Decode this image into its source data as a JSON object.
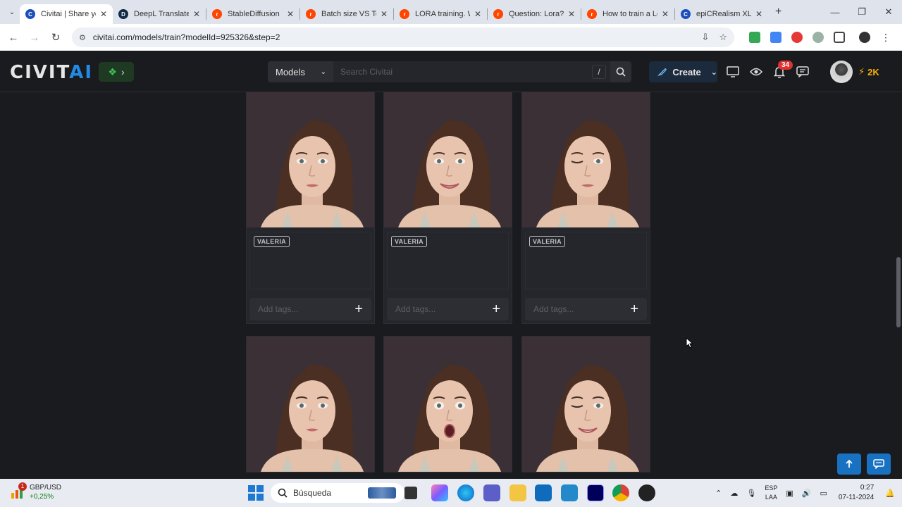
{
  "browser": {
    "tabs": [
      {
        "title": "Civitai | Share yo",
        "favicon_color": "#1c4fbd",
        "favicon": "C",
        "active": true
      },
      {
        "title": "DeepL Translate",
        "favicon_color": "#0f2b46",
        "favicon": "D",
        "active": false
      },
      {
        "title": "StableDiffusion",
        "favicon_color": "#ff4500",
        "favicon": "r",
        "active": false
      },
      {
        "title": "Batch size VS Tot",
        "favicon_color": "#ff4500",
        "favicon": "r",
        "active": false
      },
      {
        "title": "LORA training. W",
        "favicon_color": "#ff4500",
        "favicon": "r",
        "active": false
      },
      {
        "title": "Question: Lora?",
        "favicon_color": "#ff4500",
        "favicon": "r",
        "active": false
      },
      {
        "title": "How to train a Lo",
        "favicon_color": "#ff4500",
        "favicon": "r",
        "active": false
      },
      {
        "title": "epiCRealism XL",
        "favicon_color": "#1c4fbd",
        "favicon": "C",
        "active": false
      }
    ],
    "url": "civitai.com/models/train?modelId=925326&step=2"
  },
  "header": {
    "logo_main": "CIVIT",
    "logo_accent": "AI",
    "search_category": "Models",
    "search_placeholder": "Search Civitai",
    "search_shortcut": "/",
    "create_label": "Create",
    "notification_count": "34",
    "buzz_amount": "2K",
    "colors": {
      "accent": "#228be6",
      "buzz": "#fab005",
      "badge": "#e03131"
    }
  },
  "cards": [
    {
      "label": "VALERIA",
      "tags_placeholder": "Add tags...",
      "expression": "neutral"
    },
    {
      "label": "VALERIA",
      "tags_placeholder": "Add tags...",
      "expression": "smile"
    },
    {
      "label": "VALERIA",
      "tags_placeholder": "Add tags...",
      "expression": "wink"
    },
    {
      "label": "",
      "tags_placeholder": "",
      "expression": "neutral"
    },
    {
      "label": "",
      "tags_placeholder": "",
      "expression": "surprised"
    },
    {
      "label": "",
      "tags_placeholder": "",
      "expression": "wink-smile"
    }
  ],
  "taskbar": {
    "widget_title": "GBP/USD",
    "widget_change": "+0,25%",
    "widget_badge": "1",
    "search_label": "Búsqueda",
    "lang_top": "ESP",
    "lang_bottom": "LAA",
    "time": "0:27",
    "date": "07-11-2024"
  }
}
